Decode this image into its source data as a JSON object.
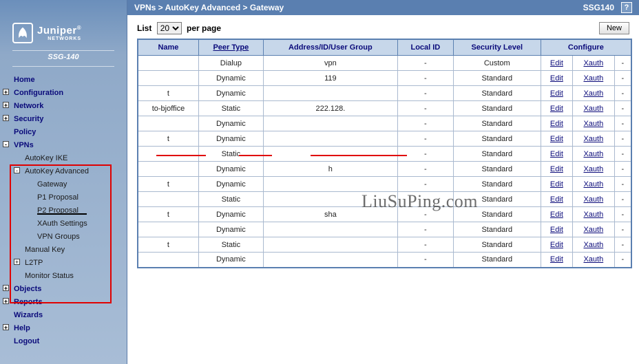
{
  "breadcrumb": "VPNs > AutoKey Advanced > Gateway",
  "device_model_top": "SSG140",
  "device_model_side": "SSG-140",
  "logo_text": "Juniper",
  "logo_sub": "NETWORKS",
  "list_prefix": "List",
  "list_suffix": "per page",
  "list_value": "20",
  "new_button": "New",
  "help_label": "?",
  "nav": {
    "home": "Home",
    "configuration": "Configuration",
    "network": "Network",
    "security": "Security",
    "policy": "Policy",
    "vpns": "VPNs",
    "autokey_ike": "AutoKey IKE",
    "autokey_adv": "AutoKey Advanced",
    "gateway": "Gateway",
    "p1": "P1 Proposal",
    "p2": "P2 Proposal",
    "xauth": "XAuth Settings",
    "vpngroups": "VPN Groups",
    "manualkey": "Manual Key",
    "l2tp": "L2TP",
    "monitor": "Monitor Status",
    "objects": "Objects",
    "reports": "Reports",
    "wizards": "Wizards",
    "help": "Help",
    "logout": "Logout"
  },
  "columns": {
    "name": "Name",
    "peer": "Peer Type",
    "addr": "Address/ID/User Group",
    "local": "Local ID",
    "sec": "Security Level",
    "conf": "Configure"
  },
  "links": {
    "edit": "Edit",
    "xauth": "Xauth"
  },
  "rows": [
    {
      "name": " ",
      "peer": "Dialup",
      "addr": "vpn",
      "local": "-",
      "sec": "Custom"
    },
    {
      "name": " ",
      "peer": "Dynamic",
      "addr": "119",
      "local": "-",
      "sec": "Standard"
    },
    {
      "name": "t ",
      "peer": "Dynamic",
      "addr": " ",
      "local": "-",
      "sec": "Standard"
    },
    {
      "name": "to-bjoffice",
      "peer": "Static",
      "addr": "222.128.",
      "local": "-",
      "sec": "Standard"
    },
    {
      "name": " ",
      "peer": "Dynamic",
      "addr": " ",
      "local": "-",
      "sec": "Standard"
    },
    {
      "name": "t ",
      "peer": "Dynamic",
      "addr": " ",
      "local": "-",
      "sec": "Standard"
    },
    {
      "name": " ",
      "peer": "Static",
      "addr": " ",
      "local": "-",
      "sec": "Standard"
    },
    {
      "name": " ",
      "peer": "Dynamic",
      "addr": "h",
      "local": "-",
      "sec": "Standard"
    },
    {
      "name": "t ",
      "peer": "Dynamic",
      "addr": " ",
      "local": "-",
      "sec": "Standard"
    },
    {
      "name": " ",
      "peer": "Static",
      "addr": " ",
      "local": "-",
      "sec": "Standard"
    },
    {
      "name": "t ",
      "peer": "Dynamic",
      "addr": "sha",
      "local": "-",
      "sec": "Standard"
    },
    {
      "name": " ",
      "peer": "Dynamic",
      "addr": " ",
      "local": "-",
      "sec": "Standard"
    },
    {
      "name": "t ",
      "peer": "Static",
      "addr": " ",
      "local": "-",
      "sec": "Standard"
    },
    {
      "name": " ",
      "peer": "Dynamic",
      "addr": " ",
      "local": "-",
      "sec": "Standard"
    }
  ],
  "watermark": "LiuSuPing.com"
}
